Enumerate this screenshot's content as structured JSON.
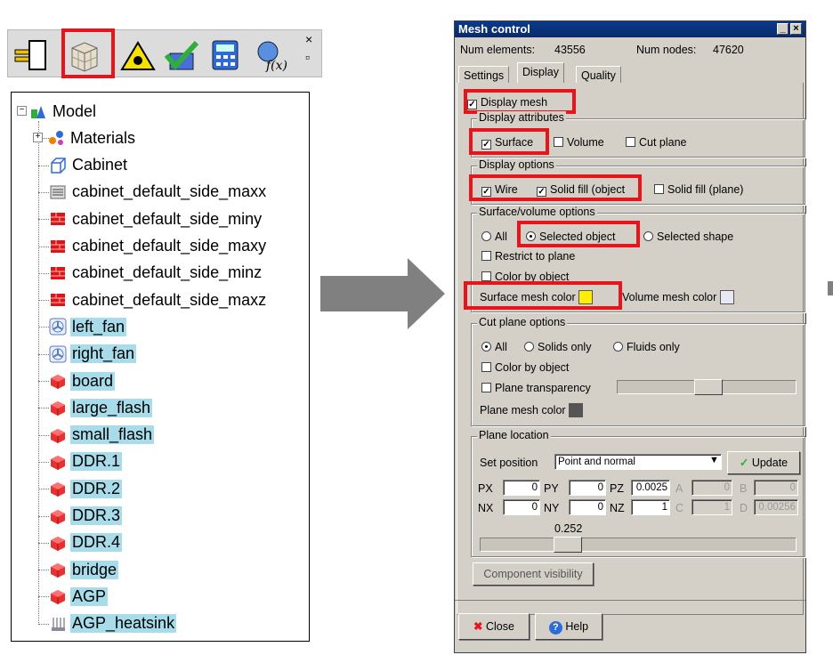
{
  "toolbar": {
    "icons": [
      "mesh-tool-icon",
      "cube-mesh-icon",
      "warning-triangle-icon",
      "check-mesh-icon",
      "calculator-icon",
      "function-fx-icon"
    ],
    "close_glyph": "×",
    "restore_glyph": "▫"
  },
  "tree": {
    "items": [
      {
        "label": "Model",
        "icon": "model-icon",
        "selected": false
      },
      {
        "label": "Materials",
        "icon": "materials-icon",
        "selected": false
      },
      {
        "label": "Cabinet",
        "icon": "cabinet-icon",
        "selected": false
      },
      {
        "label": "cabinet_default_side_maxx",
        "icon": "grille-icon",
        "selected": false
      },
      {
        "label": "cabinet_default_side_miny",
        "icon": "wall-icon",
        "selected": false
      },
      {
        "label": "cabinet_default_side_maxy",
        "icon": "wall-icon",
        "selected": false
      },
      {
        "label": "cabinet_default_side_minz",
        "icon": "wall-icon",
        "selected": false
      },
      {
        "label": "cabinet_default_side_maxz",
        "icon": "wall-icon",
        "selected": false
      },
      {
        "label": "left_fan",
        "icon": "fan-icon",
        "selected": true
      },
      {
        "label": "right_fan",
        "icon": "fan-icon",
        "selected": true
      },
      {
        "label": "board",
        "icon": "block-icon",
        "selected": true
      },
      {
        "label": "large_flash",
        "icon": "block-icon",
        "selected": true
      },
      {
        "label": "small_flash",
        "icon": "block-icon",
        "selected": true
      },
      {
        "label": "DDR.1",
        "icon": "block-icon",
        "selected": true
      },
      {
        "label": "DDR.2",
        "icon": "block-icon",
        "selected": true
      },
      {
        "label": "DDR.3",
        "icon": "block-icon",
        "selected": true
      },
      {
        "label": "DDR.4",
        "icon": "block-icon",
        "selected": true
      },
      {
        "label": "bridge",
        "icon": "block-icon",
        "selected": true
      },
      {
        "label": "AGP",
        "icon": "block-icon",
        "selected": true
      },
      {
        "label": "AGP_heatsink",
        "icon": "heatsink-icon",
        "selected": true
      }
    ]
  },
  "dialog": {
    "title": "Mesh control",
    "num_elements_label": "Num elements:",
    "num_elements": "43556",
    "num_nodes_label": "Num nodes:",
    "num_nodes": "47620",
    "tabs": [
      "Settings",
      "Display",
      "Quality"
    ],
    "display_mesh": "Display mesh",
    "display_attributes": {
      "title": "Display attributes",
      "surface": "Surface",
      "volume": "Volume",
      "cut_plane": "Cut plane"
    },
    "display_options": {
      "title": "Display options",
      "wire": "Wire",
      "solid_fill_object": "Solid fill (object",
      "solid_fill_plane": "Solid fill (plane)"
    },
    "surface_volume": {
      "title": "Surface/volume options",
      "all": "All",
      "selected_object": "Selected object",
      "selected_shape": "Selected shape",
      "restrict_to_plane": "Restrict to plane",
      "color_by_object": "Color by object",
      "surface_mesh_color": "Surface mesh color",
      "volume_mesh_color": "Volume mesh color"
    },
    "cut_plane_options": {
      "title": "Cut plane options",
      "all": "All",
      "solids_only": "Solids only",
      "fluids_only": "Fluids only",
      "color_by_object": "Color by object",
      "plane_transparency": "Plane transparency",
      "plane_mesh_color": "Plane mesh color"
    },
    "plane_location": {
      "title": "Plane location",
      "set_position": "Set position",
      "position_value": "Point and normal",
      "update": "Update",
      "px_label": "PX",
      "px": "0",
      "py_label": "PY",
      "py": "0",
      "pz_label": "PZ",
      "pz": "0.0025",
      "a_label": "A",
      "a": "0",
      "b_label": "B",
      "b": "0",
      "nx_label": "NX",
      "nx": "0",
      "ny_label": "NY",
      "ny": "0",
      "nz_label": "NZ",
      "nz": "1",
      "c_label": "C",
      "c": "1",
      "d_label": "D",
      "d": "0.00256",
      "slider_value": "0.252"
    },
    "component_visibility": "Component visibility",
    "close": "Close",
    "help": "Help"
  },
  "colors": {
    "highlight_red": "#e8141b",
    "selection_blue": "#a8dcea",
    "surface_mesh": "#ffee00",
    "volume_mesh": "#e8e8f4",
    "plane_mesh": "#555555",
    "arrow": "#808080"
  }
}
